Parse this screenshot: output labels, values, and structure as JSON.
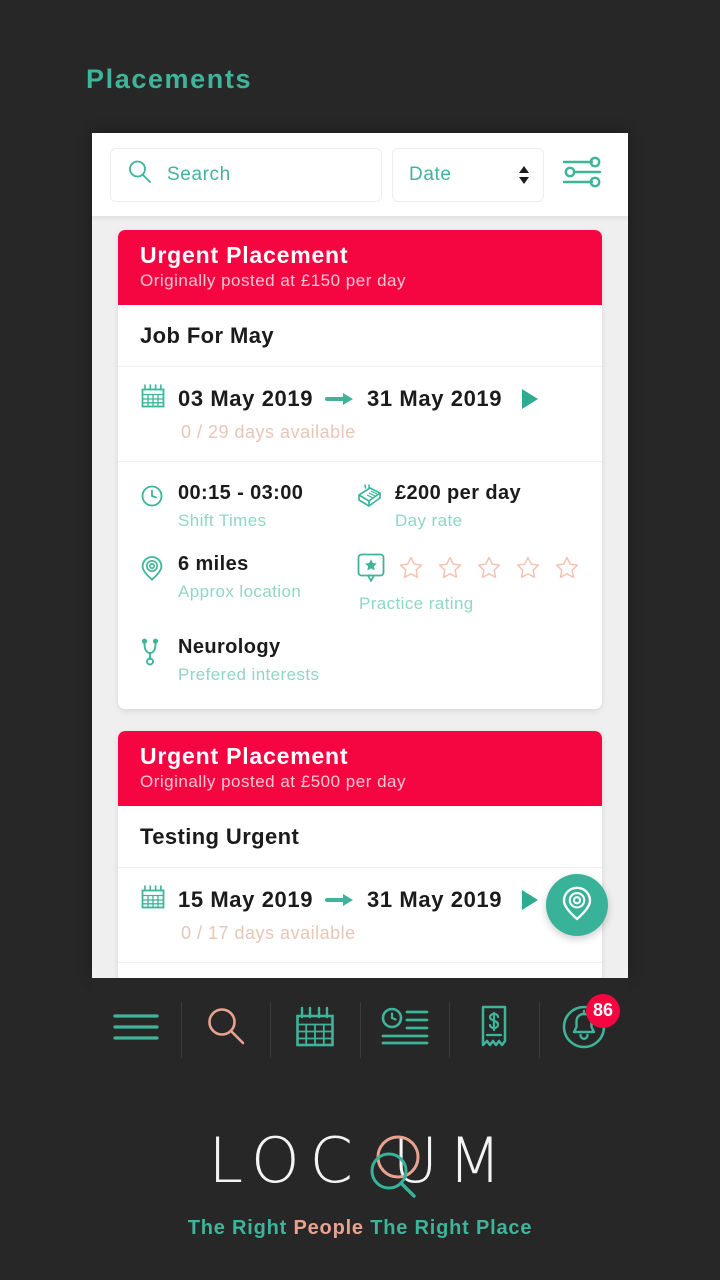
{
  "page": {
    "title": "Placements",
    "accent_teal": "#3eb49a",
    "accent_red": "#f50640",
    "accent_salmon": "#e8a390",
    "background": "#272727"
  },
  "search": {
    "placeholder": "Search",
    "value": "",
    "icon": "search-icon",
    "sort": {
      "label": "Date",
      "icon": "stepper-updown-icon"
    },
    "filter_icon": "sliders-filter-icon"
  },
  "placements": [
    {
      "urgent_title": "Urgent Placement",
      "urgent_subtitle": "Originally posted at £150 per day",
      "job_title": "Job For May",
      "start_date": "03 May 2019",
      "end_date": "31 May 2019",
      "days_available": "0 / 29 days available",
      "details": {
        "shift_times_value": "00:15 - 03:00",
        "shift_times_label": "Shift Times",
        "day_rate_value": "£200 per day",
        "day_rate_label": "Day rate",
        "location_value": "6 miles",
        "location_label": "Approx location",
        "rating_label": "Practice rating",
        "rating_stars_total": 5,
        "rating_stars_filled": 0,
        "interests_value": "Neurology",
        "interests_label": "Prefered interests"
      }
    },
    {
      "urgent_title": "Urgent Placement",
      "urgent_subtitle": "Originally posted at £500 per day",
      "job_title": "Testing Urgent",
      "start_date": "15 May 2019",
      "end_date": "31 May 2019",
      "days_available": "0 / 17 days available"
    }
  ],
  "fab": {
    "icon": "map-pin-icon"
  },
  "bottom_nav": [
    {
      "name": "menu",
      "icon": "hamburger-menu-icon",
      "color": "#3eb49a"
    },
    {
      "name": "search",
      "icon": "search-icon",
      "color": "#e8a390"
    },
    {
      "name": "calendar",
      "icon": "calendar-icon",
      "color": "#3eb49a"
    },
    {
      "name": "timesheets",
      "icon": "list-clock-icon",
      "color": "#3eb49a"
    },
    {
      "name": "invoices",
      "icon": "receipt-dollar-icon",
      "color": "#3eb49a"
    },
    {
      "name": "notifications",
      "icon": "bell-icon",
      "color": "#3eb49a",
      "badge": "86"
    }
  ],
  "footer": {
    "logo_text": "LOC UM",
    "logo_mark": "magnifier-o-icon",
    "tagline_part1": "The Right ",
    "tagline_highlight": "People",
    "tagline_part2": " The Right Place"
  }
}
